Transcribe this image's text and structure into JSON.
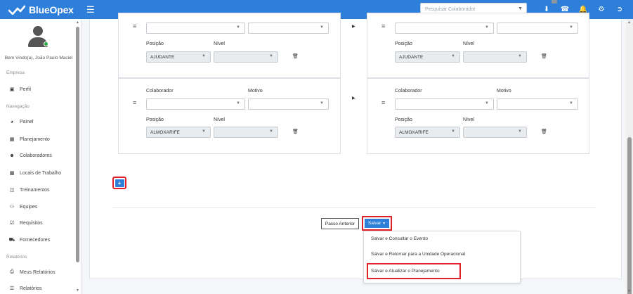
{
  "topbar": {
    "brand": "BlueOpex",
    "search_placeholder": "Pesquisar Colaborador",
    "icons": [
      "download-icon",
      "headset-icon",
      "bell-icon",
      "gear-icon",
      "logout-icon"
    ]
  },
  "sidebar": {
    "welcome": "Bem Vindo(a), João Paulo Maciel",
    "sections": {
      "empresa": "Empresa",
      "navegacao": "Navegação",
      "relatorios": "Relatórios"
    },
    "items": {
      "perfil": "Perfil",
      "painel": "Painel",
      "planejamento": "Planejamento",
      "colaboradores": "Colaboradores",
      "locais": "Locais de Trabalho",
      "treinamentos": "Treinamentos",
      "equipes": "Equipes",
      "requisitos": "Requisitos",
      "fornecedores": "Fornecedores",
      "meus_relatorios": "Meus Relatórios",
      "relatorios": "Relatórios"
    }
  },
  "form": {
    "labels": {
      "colaborador": "Colaborador",
      "motivo": "Motivo",
      "posicao": "Posição",
      "nivel": "Nível"
    },
    "row1_left_posicao": "AJUDANTE",
    "row1_right_posicao": "AJUDANTE",
    "row2_left_posicao": "ALMOXARIFE",
    "row2_right_posicao": "ALMOXARIFE",
    "add_label": "+"
  },
  "actions": {
    "prev_label": "Passo Anterior",
    "save_label": "Salvar",
    "dropdown": [
      "Salvar e Consultar o Evento",
      "Salvar e Retornar para a Unidade Operacional",
      "Salvar e Atualizar o Planejamento"
    ]
  }
}
